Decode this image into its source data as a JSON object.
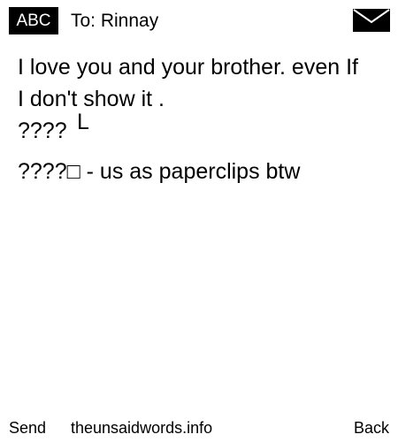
{
  "header": {
    "mode": "ABC",
    "recipient": "To: Rinnay",
    "icon": "envelope-icon"
  },
  "message": {
    "lines": [
      "I love you and your brother. even If",
      "I don't show it .",
      "????",
      "????□  -  us as paperclips btw"
    ],
    "line3_superscript": "L"
  },
  "footer": {
    "left_softkey": "Send",
    "center_text": "theunsaidwords.info",
    "right_softkey": "Back"
  }
}
